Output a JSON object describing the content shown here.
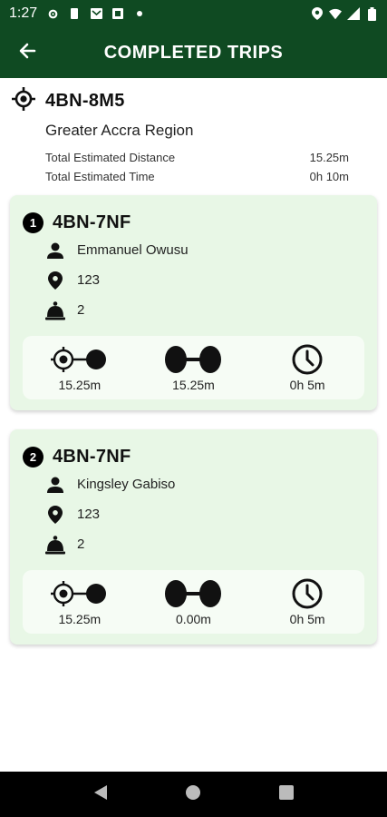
{
  "status_bar": {
    "time": "1:27"
  },
  "app_bar": {
    "title": "COMPLETED TRIPS"
  },
  "summary": {
    "code": "4BN-8M5",
    "region": "Greater Accra Region",
    "distance_label": "Total Estimated Distance",
    "distance_value": "15.25m",
    "time_label": "Total Estimated Time",
    "time_value": "0h 10m"
  },
  "trips": [
    {
      "index": "1",
      "code": "4BN-7NF",
      "name": "Emmanuel Owusu",
      "location": "123",
      "count": "2",
      "metric_from": "15.25m",
      "metric_between": "15.25m",
      "metric_time": "0h 5m"
    },
    {
      "index": "2",
      "code": "4BN-7NF",
      "name": "Kingsley Gabiso",
      "location": "123",
      "count": "2",
      "metric_from": "15.25m",
      "metric_between": "0.00m",
      "metric_time": "0h 5m"
    }
  ],
  "colors": {
    "brand": "#0f4a22",
    "card_bg": "#e8f7e6"
  }
}
